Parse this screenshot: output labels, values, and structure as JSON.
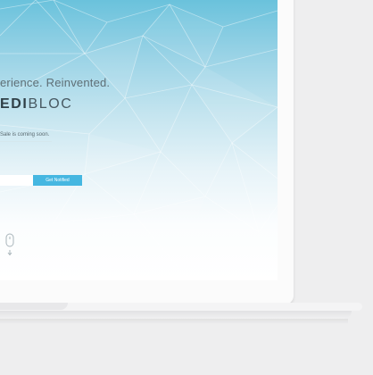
{
  "hero": {
    "headline": "erience. Reinvented.",
    "logo_bold": "EDI",
    "logo_light": "BLOC",
    "sale_text": "Sale is coming soon."
  },
  "signup": {
    "email_placeholder": "",
    "button_label": "Get Notified"
  },
  "icons": [
    "mouse-scroll-icon"
  ],
  "colors": {
    "accent": "#46b7e1",
    "screen_top": "#6ac2dc",
    "device_body": "#fbfbfb",
    "background": "#eeeeef"
  }
}
